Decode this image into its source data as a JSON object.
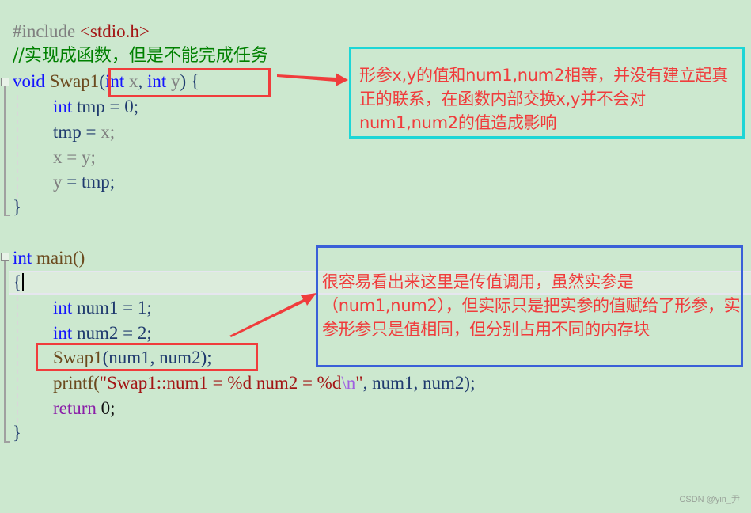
{
  "editor": {
    "lines": {
      "include_directive": "#include",
      "include_header": "<stdio.h>",
      "comment": "//实现成函数，但是不能完成任务",
      "swap_kw_void": "void",
      "swap_name": "Swap1",
      "swap_params_open": "(",
      "swap_kw_int1": "int",
      "swap_param_x": "x",
      "swap_comma": ",",
      "swap_kw_int2": "int",
      "swap_param_y": "y",
      "swap_params_close": ")",
      "swap_brace_open": "{",
      "tmp_decl_kw": "int",
      "tmp_decl_rest": "tmp = 0;",
      "tmp_assign": "tmp = ",
      "tmp_assign_x": "x;",
      "x_assign": "x = y;",
      "y_assign_lhs": "y",
      "y_assign_rhs": " = tmp;",
      "swap_brace_close": "}",
      "main_kw_int": "int",
      "main_name": "main()",
      "main_brace_open": "{",
      "num1_kw": "int",
      "num1_rest": "num1 = 1;",
      "num2_kw": "int",
      "num2_rest": "num2 = 2;",
      "call_name": "Swap1",
      "call_args": "(num1, num2);",
      "printf_name": "printf(",
      "printf_str": "\"Swap1::num1 = %d num2 = %d",
      "printf_esc": "\\n",
      "printf_str_end": "\"",
      "printf_args": ", num1, num2);",
      "return_kw": "return",
      "return_val": " 0;",
      "main_brace_close": "}"
    }
  },
  "annotations": {
    "params_note": "形参x,y的值和num1,num2相等，并没有建立起真正的联系，在函数内部交换x,y并不会对num1,num2的值造成影响",
    "call_note": "很容易看出来这里是传值调用，虽然实参是（num1,num2），但实际只是把实参的值赋给了形参，实参形参只是值相同，但分别占用不同的内存块"
  },
  "colors": {
    "background": "#cce8cf",
    "highlight_red": "#f03c3c",
    "cyan_box": "#1cd6d6",
    "blue_box": "#3a5fd8"
  },
  "watermark": "CSDN @yin_尹"
}
